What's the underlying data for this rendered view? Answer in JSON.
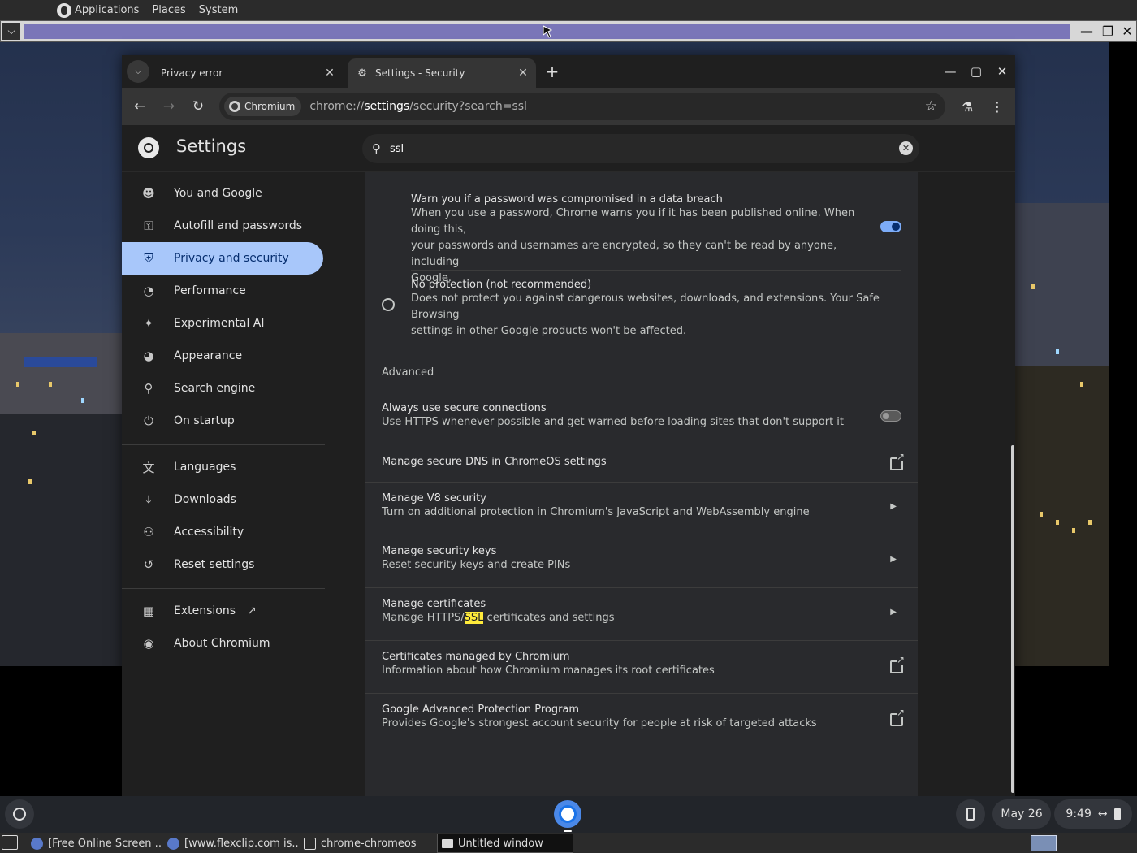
{
  "gnome_panel": {
    "applications": "Applications",
    "places": "Places",
    "system": "System"
  },
  "browser": {
    "tabs": [
      {
        "label": "Privacy error",
        "active": false
      },
      {
        "label": "Settings - Security",
        "active": true
      }
    ],
    "omnibox": {
      "chip": "Chromium",
      "url_prefix": "chrome://",
      "url_host": "settings",
      "url_path": "/security?search=ssl"
    }
  },
  "settings": {
    "title": "Settings",
    "search_value": "ssl",
    "sidebar": {
      "items": [
        {
          "label": "You and Google",
          "icon": "person-icon"
        },
        {
          "label": "Autofill and passwords",
          "icon": "key-icon"
        },
        {
          "label": "Privacy and security",
          "icon": "shield-icon",
          "selected": true
        },
        {
          "label": "Performance",
          "icon": "speedometer-icon"
        },
        {
          "label": "Experimental AI",
          "icon": "sparkle-icon"
        },
        {
          "label": "Appearance",
          "icon": "palette-icon"
        },
        {
          "label": "Search engine",
          "icon": "search-icon"
        },
        {
          "label": "On startup",
          "icon": "power-icon"
        },
        {
          "label": "Languages",
          "icon": "translate-icon"
        },
        {
          "label": "Downloads",
          "icon": "download-icon"
        },
        {
          "label": "Accessibility",
          "icon": "accessibility-icon"
        },
        {
          "label": "Reset settings",
          "icon": "reset-icon"
        },
        {
          "label": "Extensions",
          "icon": "puzzle-icon"
        },
        {
          "label": "About Chromium",
          "icon": "chromium-icon"
        }
      ]
    },
    "content": {
      "breach": {
        "title": "Warn you if a password was compromised in a data breach",
        "line1": "When you use a password, Chrome warns you if it has been published online. When doing this,",
        "line2": "your passwords and usernames are encrypted, so they can't be read by anyone, including",
        "line3": "Google.",
        "enabled": true
      },
      "no_protection": {
        "title": "No protection (not recommended)",
        "line1": "Does not protect you against dangerous websites, downloads, and extensions. Your Safe Browsing",
        "line2": "settings in other Google products won't be affected."
      },
      "advanced_label": "Advanced",
      "https": {
        "title": "Always use secure connections",
        "sub": "Use HTTPS whenever possible and get warned before loading sites that don't support it",
        "enabled": false
      },
      "dns": {
        "title": "Manage secure DNS in ChromeOS settings"
      },
      "v8": {
        "title": "Manage V8 security",
        "sub": "Turn on additional protection in Chromium's JavaScript and WebAssembly engine"
      },
      "keys": {
        "title": "Manage security keys",
        "sub": "Reset security keys and create PINs"
      },
      "certs": {
        "title": "Manage certificates",
        "sub_before": "Manage HTTPS/",
        "sub_highlight": "SSL",
        "sub_after": " certificates and settings"
      },
      "managed_certs": {
        "title": "Certificates managed by Chromium",
        "sub": "Information about how Chromium manages its root certificates"
      },
      "gapp": {
        "title": "Google Advanced Protection Program",
        "sub": "Provides Google's strongest account security for people at risk of targeted attacks"
      }
    }
  },
  "shelf": {
    "date": "May 26",
    "time": "9:49"
  },
  "taskbar": {
    "tasks": [
      {
        "label": "[Free Online Screen ..."
      },
      {
        "label": "[www.flexclip.com is..."
      },
      {
        "label": "chrome-chromeos"
      },
      {
        "label": "Untitled window"
      }
    ]
  },
  "colors": {
    "accent": "#a8c7fa",
    "toggle_on": "#7cacf8",
    "highlight": "#ffeb3b"
  }
}
